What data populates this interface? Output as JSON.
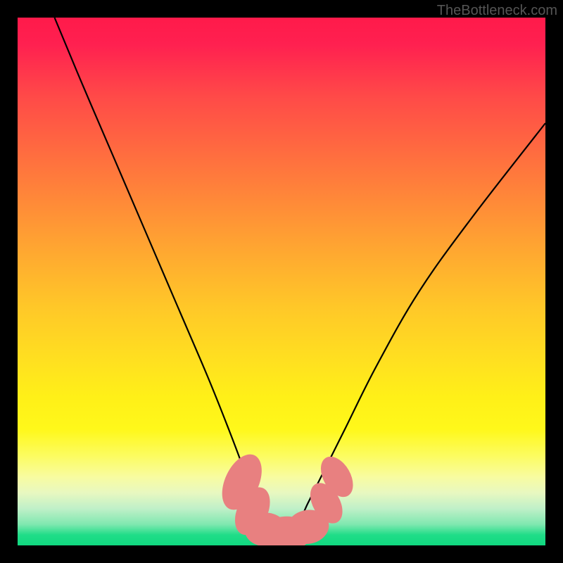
{
  "watermark": "TheBottleneck.com",
  "chart_data": {
    "type": "line",
    "title": "",
    "xlabel": "",
    "ylabel": "",
    "ylim": [
      0,
      100
    ],
    "xlim": [
      0,
      100
    ],
    "series": [
      {
        "name": "bottleneck-curve",
        "x": [
          7,
          12,
          18,
          24,
          30,
          36,
          40,
          43,
          45,
          47,
          50,
          53,
          55,
          58,
          62,
          68,
          76,
          86,
          100
        ],
        "values": [
          100,
          88,
          74,
          60,
          46,
          32,
          22,
          14,
          8,
          4,
          2,
          4,
          8,
          14,
          22,
          34,
          48,
          62,
          80
        ]
      }
    ],
    "markers": [
      {
        "x": 42.5,
        "y": 12,
        "rx": 2.0,
        "ry": 3.5,
        "rot": 25
      },
      {
        "x": 44.5,
        "y": 6.5,
        "rx": 1.8,
        "ry": 3.0,
        "rot": 25
      },
      {
        "x": 47.0,
        "y": 3.0,
        "rx": 2.5,
        "ry": 2.0,
        "rot": 0
      },
      {
        "x": 51.0,
        "y": 2.3,
        "rx": 3.0,
        "ry": 2.0,
        "rot": 0
      },
      {
        "x": 55.0,
        "y": 3.5,
        "rx": 2.5,
        "ry": 2.0,
        "rot": -10
      },
      {
        "x": 58.5,
        "y": 8.0,
        "rx": 1.6,
        "ry": 2.6,
        "rot": -30
      },
      {
        "x": 60.5,
        "y": 13.0,
        "rx": 1.6,
        "ry": 2.6,
        "rot": -30
      }
    ],
    "gradient_stops": [
      {
        "pos": 0,
        "color": "#ff1a4a"
      },
      {
        "pos": 50,
        "color": "#ffc020"
      },
      {
        "pos": 85,
        "color": "#fff860"
      },
      {
        "pos": 100,
        "color": "#10d880"
      }
    ]
  }
}
